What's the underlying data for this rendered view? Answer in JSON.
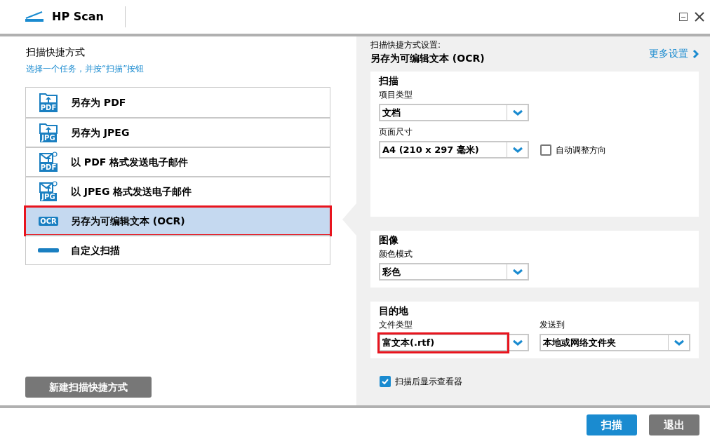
{
  "window": {
    "title": "HP Scan"
  },
  "shortcuts": {
    "title": "扫描快捷方式",
    "hint": "选择一个任务，并按“扫描”按钮",
    "items": [
      {
        "label": "另存为 PDF",
        "kind": "folder",
        "badge": "PDF",
        "selected": false,
        "annotated": false
      },
      {
        "label": "另存为 JPEG",
        "kind": "folder",
        "badge": "JPG",
        "selected": false,
        "annotated": false
      },
      {
        "label": "以 PDF 格式发送电子邮件",
        "kind": "mail",
        "badge": "PDF",
        "selected": false,
        "annotated": false
      },
      {
        "label": "以 JPEG 格式发送电子邮件",
        "kind": "mail",
        "badge": "JPG",
        "selected": false,
        "annotated": false
      },
      {
        "label": "另存为可编辑文本 (OCR)",
        "kind": "badge",
        "badge": "OCR",
        "selected": true,
        "annotated": true
      },
      {
        "label": "自定义扫描",
        "kind": "scanner",
        "selected": false,
        "annotated": false
      }
    ],
    "new_button": "新建扫描快捷方式"
  },
  "settings": {
    "caption": "扫描快捷方式设置:",
    "name": "另存为可编辑文本 (OCR)",
    "more_link": "更多设置",
    "sections": [
      {
        "title": "扫描",
        "kind": "stack",
        "fields": [
          {
            "label": "项目类型",
            "value": "文档",
            "annotated": false
          },
          {
            "label": "页面尺寸",
            "value": "A4 (210 x 297 毫米)",
            "annotated": false,
            "checkbox": {
              "label": "自动调整方向",
              "checked": false
            }
          }
        ]
      },
      {
        "title": "图像",
        "kind": "stack",
        "fields": [
          {
            "label": "颜色模式",
            "value": "彩色",
            "annotated": false
          }
        ]
      },
      {
        "title": "目的地",
        "kind": "row",
        "fields": [
          {
            "label": "文件类型",
            "value": "富文本(.rtf)",
            "annotated": true
          },
          {
            "label": "发送到",
            "value": "本地或网络文件夹",
            "annotated": false
          }
        ]
      }
    ],
    "show_viewer": {
      "label": "扫描后显示查看器",
      "checked": true
    }
  },
  "buttons": [
    {
      "label": "扫描",
      "kind": "primary"
    },
    {
      "label": "退出",
      "kind": "secondary"
    }
  ]
}
